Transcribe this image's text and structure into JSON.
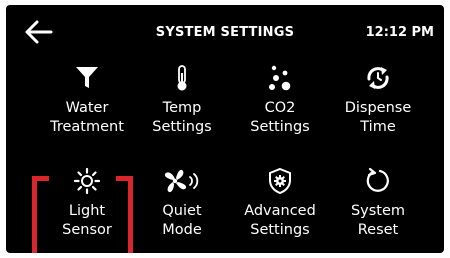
{
  "header": {
    "title": "SYSTEM SETTINGS",
    "time": "12:12 PM",
    "back_icon": "arrow-left-icon"
  },
  "tiles": [
    {
      "line1": "Water",
      "line2": "Treatment",
      "icon": "filter-funnel-icon"
    },
    {
      "line1": "Temp",
      "line2": "Settings",
      "icon": "thermometer-icon"
    },
    {
      "line1": "CO2",
      "line2": "Settings",
      "icon": "bubbles-icon"
    },
    {
      "line1": "Dispense",
      "line2": "Time",
      "icon": "timer-refresh-icon"
    },
    {
      "line1": "Light",
      "line2": "Sensor",
      "icon": "sun-icon",
      "selected": true
    },
    {
      "line1": "Quiet",
      "line2": "Mode",
      "icon": "fan-sound-icon"
    },
    {
      "line1": "Advanced",
      "line2": "Settings",
      "icon": "shield-gear-icon"
    },
    {
      "line1": "System",
      "line2": "Reset",
      "icon": "reset-circle-arrow-icon"
    }
  ],
  "colors": {
    "background": "#000000",
    "text": "#ffffff",
    "selection": "#d9262a"
  }
}
